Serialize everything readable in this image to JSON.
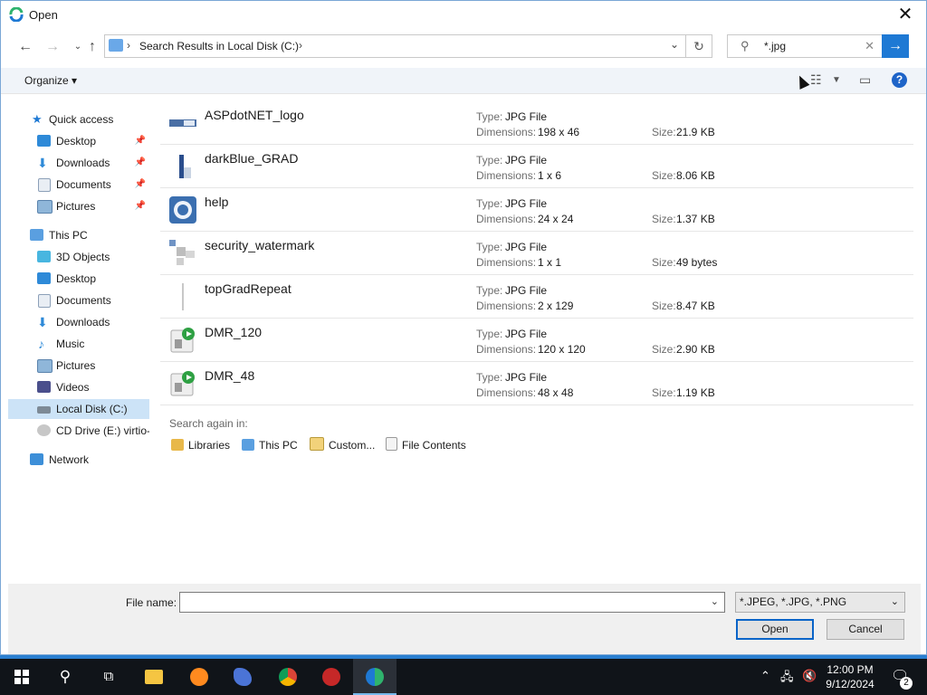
{
  "window": {
    "title": "Open"
  },
  "address": {
    "path": "Search Results in Local Disk (C:)"
  },
  "search": {
    "value": "*.jpg"
  },
  "toolbar": {
    "organize_label": "Organize"
  },
  "nav": {
    "items": [
      {
        "label": "Quick access"
      },
      {
        "label": "Desktop"
      },
      {
        "label": "Downloads"
      },
      {
        "label": "Documents"
      },
      {
        "label": "Pictures"
      },
      {
        "label": "This PC"
      },
      {
        "label": "3D Objects"
      },
      {
        "label": "Desktop"
      },
      {
        "label": "Documents"
      },
      {
        "label": "Downloads"
      },
      {
        "label": "Music"
      },
      {
        "label": "Pictures"
      },
      {
        "label": "Videos"
      },
      {
        "label": "Local Disk (C:)"
      },
      {
        "label": "CD Drive (E:) virtio-win"
      },
      {
        "label": "Network"
      }
    ]
  },
  "results": {
    "labels": {
      "type": "Type:",
      "dimensions": "Dimensions:",
      "size": "Size:"
    },
    "items": [
      {
        "name": "ASPdotNET_logo",
        "type": "JPG File",
        "dimensions": "198 x 46",
        "size": "21.9 KB"
      },
      {
        "name": "darkBlue_GRAD",
        "type": "JPG File",
        "dimensions": "1 x 6",
        "size": "8.06 KB"
      },
      {
        "name": "help",
        "type": "JPG File",
        "dimensions": "24 x 24",
        "size": "1.37 KB"
      },
      {
        "name": "security_watermark",
        "type": "JPG File",
        "dimensions": "1 x 1",
        "size": "49 bytes"
      },
      {
        "name": "topGradRepeat",
        "type": "JPG File",
        "dimensions": "2 x 129",
        "size": "8.47 KB"
      },
      {
        "name": "DMR_120",
        "type": "JPG File",
        "dimensions": "120 x 120",
        "size": "2.90 KB"
      },
      {
        "name": "DMR_48",
        "type": "JPG File",
        "dimensions": "48 x 48",
        "size": "1.19 KB"
      }
    ]
  },
  "search_again": {
    "label": "Search again in:",
    "items": [
      {
        "label": "Libraries"
      },
      {
        "label": "This PC"
      },
      {
        "label": "Custom..."
      },
      {
        "label": "File Contents"
      }
    ]
  },
  "footer": {
    "file_name_label": "File name:",
    "file_name_value": "",
    "filter_value": "*.JPEG, *.JPG, *.PNG",
    "open_label": "Open",
    "cancel_label": "Cancel"
  },
  "taskbar": {
    "time": "12:00 PM",
    "date": "9/12/2024",
    "notification_count": "2"
  },
  "colors": {
    "accent": "#1e79d4",
    "selected": "#cce3f7",
    "taskbar": "#101419"
  }
}
